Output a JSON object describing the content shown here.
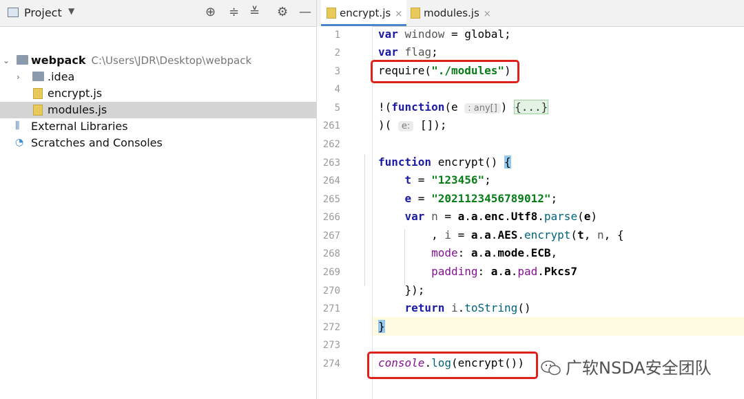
{
  "project": {
    "title": "Project",
    "tree": [
      {
        "label": "webpack",
        "path": "C:\\Users\\JDR\\Desktop\\webpack"
      },
      {
        "label": ".idea"
      },
      {
        "label": "encrypt.js"
      },
      {
        "label": "modules.js"
      },
      {
        "label": "External Libraries"
      },
      {
        "label": "Scratches and Consoles"
      }
    ]
  },
  "tabs": [
    {
      "label": "encrypt.js",
      "close": "×"
    },
    {
      "label": "modules.js",
      "close": "×"
    }
  ],
  "line_numbers": [
    "1",
    "2",
    "3",
    "4",
    "5",
    "261",
    "262",
    "263",
    "264",
    "265",
    "266",
    "267",
    "268",
    "269",
    "270",
    "271",
    "272",
    "273",
    "274"
  ],
  "code_text": {
    "l5_hint": ": any[]",
    "l5_fold": "{...}",
    "l261_hint": "e:"
  },
  "watermark": "广软NSDA安全团队",
  "colors": {
    "keyword": "#1a1aa6",
    "string": "#067d17",
    "highlight_box": "#e0201a",
    "selection": "#d4d4d4"
  }
}
